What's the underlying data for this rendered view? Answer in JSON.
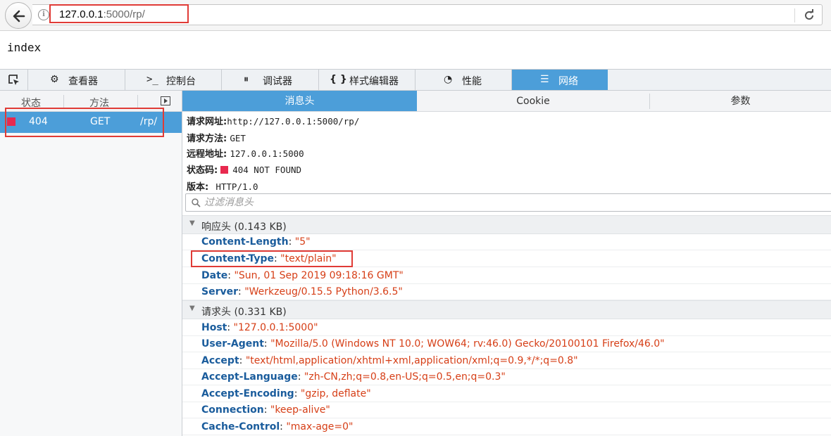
{
  "browser": {
    "url_host": "127.0.0.1",
    "url_rest": ":5000/rp/",
    "back_icon": "back-arrow-icon",
    "info_icon": "info-icon",
    "reload_icon": "reload-icon"
  },
  "page": {
    "body_text": "index"
  },
  "devtools": {
    "tabs": [
      {
        "icon": "gear-icon",
        "label": "查看器"
      },
      {
        "icon": "console-icon",
        "label": "控制台"
      },
      {
        "icon": "pause-icon",
        "label": "调试器"
      },
      {
        "icon": "braces-icon",
        "label": "样式编辑器"
      },
      {
        "icon": "performance-icon",
        "label": "性能"
      },
      {
        "icon": "network-icon",
        "label": "网络"
      }
    ],
    "active_tab": "网络",
    "accent_color": "#4c9ed9"
  },
  "requests": {
    "columns": [
      "状态",
      "方法"
    ],
    "rows": [
      {
        "status": "404",
        "method": "GET",
        "file": "/rp/",
        "status_color": "#e8294f"
      }
    ]
  },
  "details": {
    "tabs": [
      "消息头",
      "Cookie",
      "参数"
    ],
    "summary": {
      "url_label": "请求网址:",
      "url_value": "http://127.0.0.1:5000/rp/",
      "method_label": "请求方法:",
      "method_value": "GET",
      "remote_label": "远程地址:",
      "remote_value": "127.0.0.1:5000",
      "status_label": "状态码:",
      "status_value": "404 NOT FOUND",
      "version_label": "版本:",
      "version_value": "HTTP/1.0"
    },
    "filter_placeholder": "过滤消息头",
    "response_headers": {
      "title": "响应头 (0.143 KB)",
      "items": [
        {
          "name": "Content-Length",
          "value": "\"5\""
        },
        {
          "name": "Content-Type",
          "value": "\"text/plain\""
        },
        {
          "name": "Date",
          "value": "\"Sun, 01 Sep 2019 09:18:16 GMT\""
        },
        {
          "name": "Server",
          "value": "\"Werkzeug/0.15.5 Python/3.6.5\""
        }
      ]
    },
    "request_headers": {
      "title": "请求头 (0.331 KB)",
      "items": [
        {
          "name": "Host",
          "value": "\"127.0.0.1:5000\""
        },
        {
          "name": "User-Agent",
          "value": "\"Mozilla/5.0 (Windows NT 10.0; WOW64; rv:46.0) Gecko/20100101 Firefox/46.0\""
        },
        {
          "name": "Accept",
          "value": "\"text/html,application/xhtml+xml,application/xml;q=0.9,*/*;q=0.8\""
        },
        {
          "name": "Accept-Language",
          "value": "\"zh-CN,zh;q=0.8,en-US;q=0.5,en;q=0.3\""
        },
        {
          "name": "Accept-Encoding",
          "value": "\"gzip, deflate\""
        },
        {
          "name": "Connection",
          "value": "\"keep-alive\""
        },
        {
          "name": "Cache-Control",
          "value": "\"max-age=0\""
        }
      ]
    },
    "name_color": "#1a5c9c",
    "value_color": "#d63e16"
  },
  "annotations": {
    "highlight_color": "#e03b36"
  }
}
